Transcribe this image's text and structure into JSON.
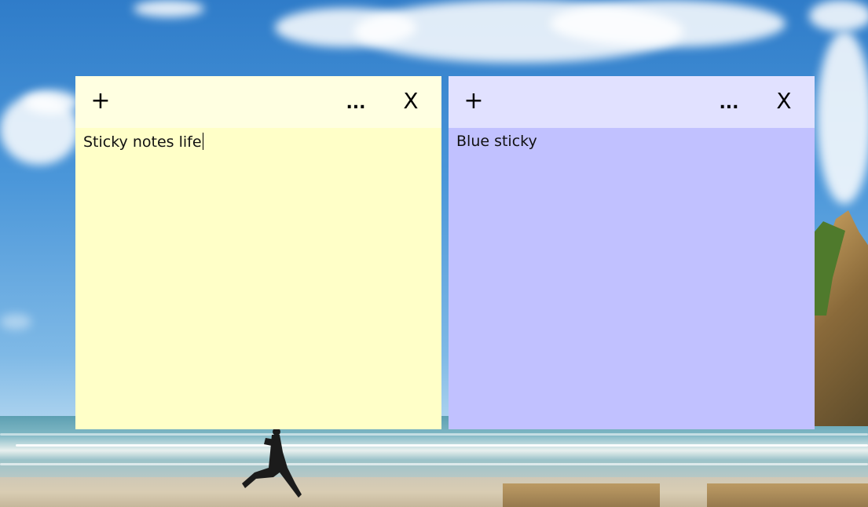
{
  "notes": [
    {
      "text": "Sticky notes life",
      "header_color": "#ffffe1",
      "body_color": "#ffffc8",
      "add_label": "+",
      "more_label": "...",
      "close_label": "X",
      "has_caret": true
    },
    {
      "text": "Blue sticky",
      "header_color": "#e1e1ff",
      "body_color": "#c1c1ff",
      "add_label": "+",
      "more_label": "...",
      "close_label": "X",
      "has_caret": false
    }
  ],
  "wallpaper": {
    "description_icon": "beach-wallpaper"
  }
}
